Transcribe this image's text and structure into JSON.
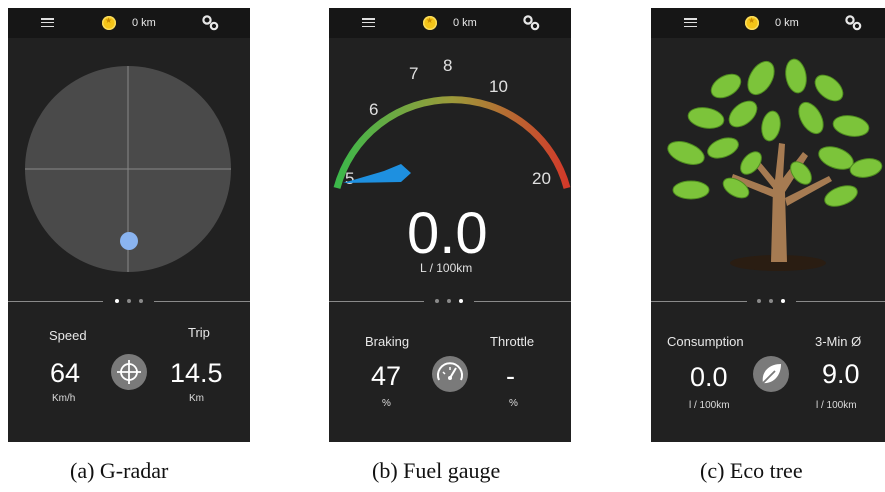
{
  "screens": [
    {
      "id": "g-radar",
      "topbar": {
        "distance": "0 km",
        "menu_icon": "menu-icon",
        "coin_icon": "coin-icon",
        "settings_icon": "gears-icon"
      },
      "left_label": "Speed",
      "left_value": "64",
      "left_unit": "Km/h",
      "center_icon": "crosshair-icon",
      "right_label": "Trip",
      "right_value": "14.5",
      "right_unit": "Km",
      "page_indicator": {
        "count": 3,
        "active": 1
      },
      "caption": "(a) G-radar"
    },
    {
      "id": "fuel-gauge",
      "topbar": {
        "distance": "0 km",
        "menu_icon": "menu-icon",
        "coin_icon": "coin-icon",
        "settings_icon": "gears-icon"
      },
      "gauge": {
        "ticks": [
          "5",
          "6",
          "7",
          "8",
          "10",
          "20"
        ],
        "value": "0.0",
        "unit": "L / 100km",
        "needle_color": "#1e90e0"
      },
      "left_label": "Braking",
      "left_value": "47",
      "left_unit": "%",
      "center_icon": "speedometer-icon",
      "right_label": "Throttle",
      "right_value": "-",
      "right_unit": "%",
      "page_indicator": {
        "count": 3,
        "active": 3
      },
      "caption": "(b) Fuel gauge"
    },
    {
      "id": "eco-tree",
      "topbar": {
        "distance": "0 km",
        "menu_icon": "menu-icon",
        "coin_icon": "coin-icon",
        "settings_icon": "gears-icon"
      },
      "tree_image": "tree-illustration",
      "left_label": "Consumption",
      "left_value": "0.0",
      "left_unit": "l / 100km",
      "center_icon": "leaf-icon",
      "right_label": "3-Min Ø",
      "right_value": "9.0",
      "right_unit": "l / 100km",
      "page_indicator": {
        "count": 3,
        "active": 3
      },
      "caption": "(c) Eco tree"
    }
  ],
  "colors": {
    "screen_bg": "#212121",
    "topbar_bg": "#161616",
    "radar_disc": "#4a4a4a",
    "radar_dot": "#8ab4f0",
    "leaf": "#7cc43a",
    "trunk": "#a67b52"
  }
}
